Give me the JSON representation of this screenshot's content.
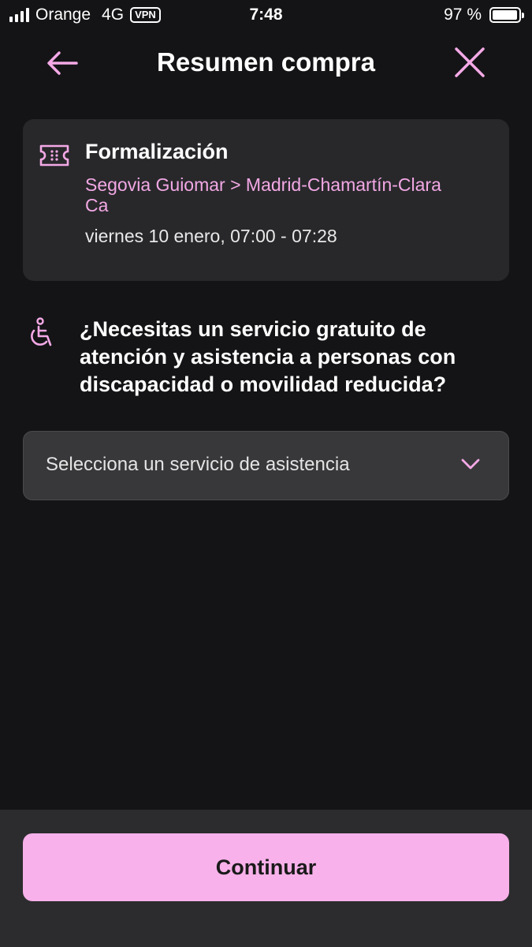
{
  "status_bar": {
    "carrier": "Orange",
    "network": "4G",
    "vpn": "VPN",
    "time": "7:48",
    "battery_text": "97 %",
    "battery_level": 0.97
  },
  "header": {
    "title": "Resumen compra",
    "back_icon": "arrow-left-icon",
    "close_icon": "close-icon"
  },
  "trip": {
    "icon": "ticket-icon",
    "title": "Formalización",
    "route": "Segovia Guiomar > Madrid-Chamartín-Clara Ca",
    "time": "viernes 10 enero, 07:00 - 07:28"
  },
  "assistance": {
    "icon": "wheelchair-icon",
    "question": "¿Necesitas un servicio gratuito de atención y asistencia a personas con discapacidad o movilidad reducida?",
    "select_placeholder": "Selecciona un servicio de asistencia"
  },
  "footer": {
    "continue_label": "Continuar"
  },
  "colors": {
    "background": "#141416",
    "card": "#28282b",
    "accent": "#f8b1ea",
    "route_text": "#f2a8e4"
  }
}
